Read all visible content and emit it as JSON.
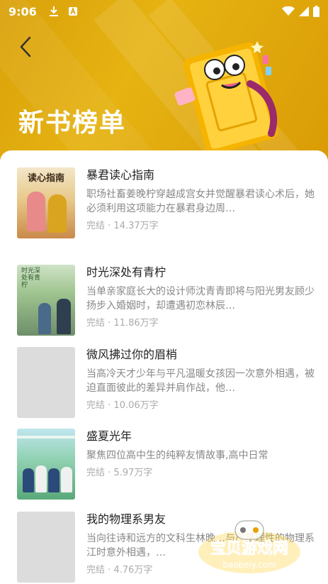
{
  "status_bar": {
    "time": "9:06"
  },
  "header": {
    "title": "新书榜单",
    "back_icon": "chevron-left-icon"
  },
  "books": [
    {
      "title": "暴君读心指南",
      "description": "职场社畜姜晚柠穿越成宫女并觉醒暴君读心术后，她必须利用这项能力在暴君身边周…",
      "status": "完结",
      "words": "14.37万字",
      "cover_label": "读心指南"
    },
    {
      "title": "时光深处有青柠",
      "description": "当单亲家庭长大的设计师沈青青即将与阳光男友顾少扬步入婚姻时，却遭遇初恋林辰…",
      "status": "完结",
      "words": "11.86万字",
      "cover_label": "时光深处有青柠"
    },
    {
      "title": "微风拂过你的眉梢",
      "description": "当高冷天才少年与平凡温暖女孩因一次意外相遇，被迫直面彼此的差异并肩作战，他…",
      "status": "完结",
      "words": "10.06万字",
      "cover_label": ""
    },
    {
      "title": "盛夏光年",
      "description": "聚焦四位高中生的纯粹友情故事,高中日常",
      "status": "完结",
      "words": "5.97万字",
      "cover_label": ""
    },
    {
      "title": "我的物理系男友",
      "description": "当向往诗和远方的文科生林晚…与严谨理性的物理系江时意外相遇，…",
      "status": "完结",
      "words": "4.76万字",
      "cover_label": ""
    }
  ],
  "separator": " · ",
  "watermark": {
    "text": "宝贝游戏网",
    "url": "baobeiy.com"
  }
}
